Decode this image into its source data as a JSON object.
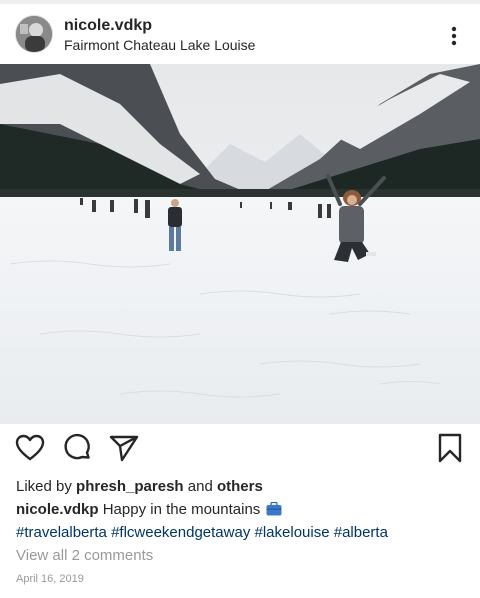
{
  "post": {
    "username": "nicole.vdkp",
    "location": "Fairmont Chateau Lake Louise",
    "likes": {
      "prefix": "Liked by",
      "user": "phresh_paresh",
      "conjunction": "and",
      "others": "others"
    },
    "caption": {
      "username": "nicole.vdkp",
      "text": "Happy in the mountains",
      "emoji": "luggage-emoji"
    },
    "hashtags": [
      "#travelalberta",
      "#flcweekendgetaway",
      "#lakelouise",
      "#alberta"
    ],
    "comments_link": "View all 2 comments",
    "date": "April 16, 2019"
  },
  "icons": {
    "more": "more-vertical-icon",
    "like": "heart-icon",
    "comment": "comment-icon",
    "share": "send-icon",
    "save": "bookmark-icon"
  },
  "colors": {
    "text": "#262626",
    "hashtag": "#003569",
    "muted": "#999999"
  }
}
